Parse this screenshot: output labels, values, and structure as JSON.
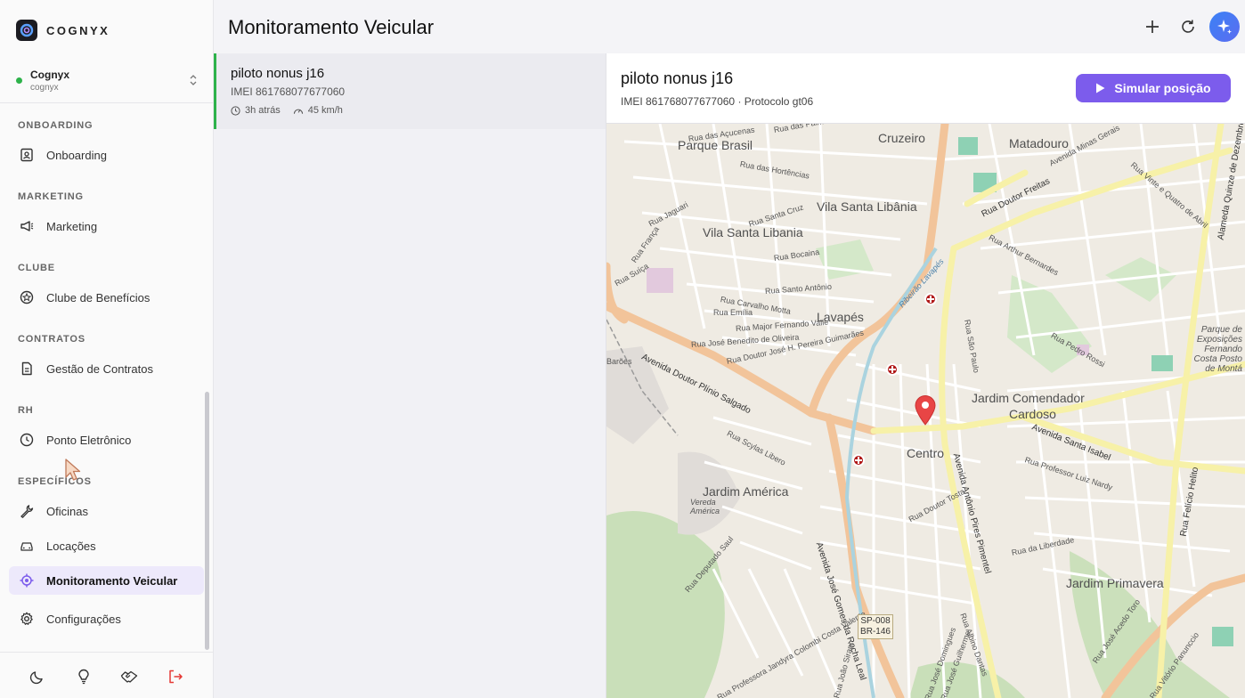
{
  "brand": {
    "name": "COGNYX"
  },
  "org": {
    "name": "Cognyx",
    "slug": "cognyx"
  },
  "sidebar": {
    "sections": [
      {
        "title": "ONBOARDING",
        "items": [
          {
            "label": "Onboarding",
            "icon": "id-badge-icon"
          }
        ]
      },
      {
        "title": "MARKETING",
        "items": [
          {
            "label": "Marketing",
            "icon": "megaphone-icon"
          }
        ]
      },
      {
        "title": "CLUBE",
        "items": [
          {
            "label": "Clube de Benefícios",
            "icon": "star-badge-icon"
          }
        ]
      },
      {
        "title": "CONTRATOS",
        "items": [
          {
            "label": "Gestão de Contratos",
            "icon": "document-icon"
          }
        ]
      },
      {
        "title": "RH",
        "items": [
          {
            "label": "Ponto Eletrônico",
            "icon": "clock-icon"
          }
        ]
      },
      {
        "title": "ESPECÍFICOS",
        "items": [
          {
            "label": "Oficinas",
            "icon": "wrench-icon"
          },
          {
            "label": "Locações",
            "icon": "car-icon"
          },
          {
            "label": "Monitoramento Veicular",
            "icon": "crosshair-icon",
            "active": true
          }
        ]
      }
    ],
    "settings_label": "Configurações"
  },
  "header": {
    "title": "Monitoramento Veicular"
  },
  "list": {
    "items": [
      {
        "title": "piloto nonus j16",
        "imei": "IMEI 861768077677060",
        "time": "3h atrás",
        "speed": "45 km/h"
      }
    ]
  },
  "detail": {
    "title": "piloto nonus j16",
    "subtitle": "IMEI 861768077677060 · Protocolo gt06",
    "simulate_label": "Simular posição"
  },
  "map": {
    "labels": {
      "cruzeiro": "Cruzeiro",
      "matadouro": "Matadouro",
      "parque_brasil": "Parque Brasil",
      "vila_santa_libania_1": "Vila Santa Libânia",
      "vila_santa_libania_2": "Vila Santa Libania",
      "lavapes": "Lavapés",
      "jardim_comendador": "Jardim Comendador",
      "cardoso": "Cardoso",
      "centro": "Centro",
      "jardim_america": "Jardim América",
      "jardim_primavera": "Jardim Primavera",
      "vereda_america": "Vereda América",
      "parque_exposicoes": "Parque de Exposições Fernando Costa Posto de Montá",
      "av_plinio": "Avenida Doutor Plínio Salgado",
      "av_jose_gomes": "Avenida José Gomes da Rocha Leal",
      "av_antonio_pires": "Avenida Antônio Pires Pimentel",
      "av_santa_isabel": "Avenida Santa Isabel",
      "av_felicio": "Rua Felício Helito",
      "av_quinze": "Alameda Quinze de Dezembro",
      "r_dr_freitas": "Rua Doutor Freitas",
      "r_dr_tosta": "Rua Doutor Tosta",
      "r_liberdade": "Rua da Liberdade",
      "r_prof_luiz": "Rua Professor Luiz Nardy",
      "r_bocaina": "Rua Bocaina",
      "r_santo_antonio": "Rua Santo Antônio",
      "r_emilia": "Rua Emília",
      "r_carvalho": "Rua Carvalho Motta",
      "r_major": "Rua Major Fernando Valle",
      "r_sao_paulo": "Rua São Paulo",
      "r_santa_cruz": "Rua Santa Cruz",
      "r_arthur": "Rua Arthur Bernardes",
      "r_pedro_rossi": "Rua Pedro Rossi",
      "r_minas_gerais": "Avenida Minas Gerais",
      "r_vinte_quatro": "Rua Vinte e Quatro de Abril",
      "r_jose_benedito": "Rua José Benedito de Oliveira",
      "r_jose_pereira": "Rua Doutor José H. Pereira Guimarães",
      "r_scylas": "Rua Scylas Libero",
      "r_deputado": "Rua Deputado Saul",
      "r_acucenas": "Rua das Açucenas",
      "r_hortencias": "Rua das Hortências",
      "r_palmeiras": "Rua das Palmeiras",
      "r_jaguari": "Rua Jaguari",
      "r_franca": "Rua França",
      "r_suica": "Rua Suíça",
      "r_barra": "Barões",
      "r_albino": "Rua Albino Dantas",
      "r_professora": "Rua Professora Jandyra Colombi Costa Valente",
      "r_joao_sirani": "Rua João Sirani",
      "r_jose_acedo": "Rua José Acedo Toro",
      "r_vitorio": "Rua Vitório Panunccio",
      "r_jose_domingues": "Rua José Domingues",
      "r_guilherme": "Rua José Guilherme",
      "ribeirao": "Ribeirão Lavapés",
      "shield_1": "SP-008",
      "shield_2": "BR-146"
    }
  },
  "footer": {
    "icons": [
      "moon-icon",
      "lightbulb-icon",
      "handshake-icon",
      "logout-icon"
    ]
  },
  "colors": {
    "accent": "#7c5cec",
    "online": "#2db24a",
    "pin": "#e84545",
    "logout": "#e53935"
  }
}
